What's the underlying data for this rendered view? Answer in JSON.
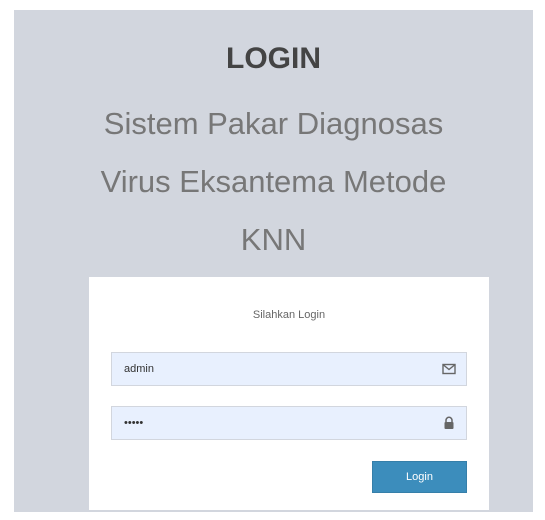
{
  "header": {
    "title": "LOGIN",
    "subtitle_lines": [
      "Sistem Pakar Diagnosas",
      "Virus Eksantema Metode",
      "KNN"
    ]
  },
  "login_box": {
    "message": "Silahkan Login",
    "username": {
      "value": "admin",
      "icon": "envelope-icon"
    },
    "password": {
      "value": "admin",
      "icon": "lock-icon"
    },
    "submit_label": "Login"
  },
  "colors": {
    "page_background": "#d2d6de",
    "box_background": "#ffffff",
    "input_background": "#e8f0fe",
    "button_background": "#3c8dbc"
  }
}
